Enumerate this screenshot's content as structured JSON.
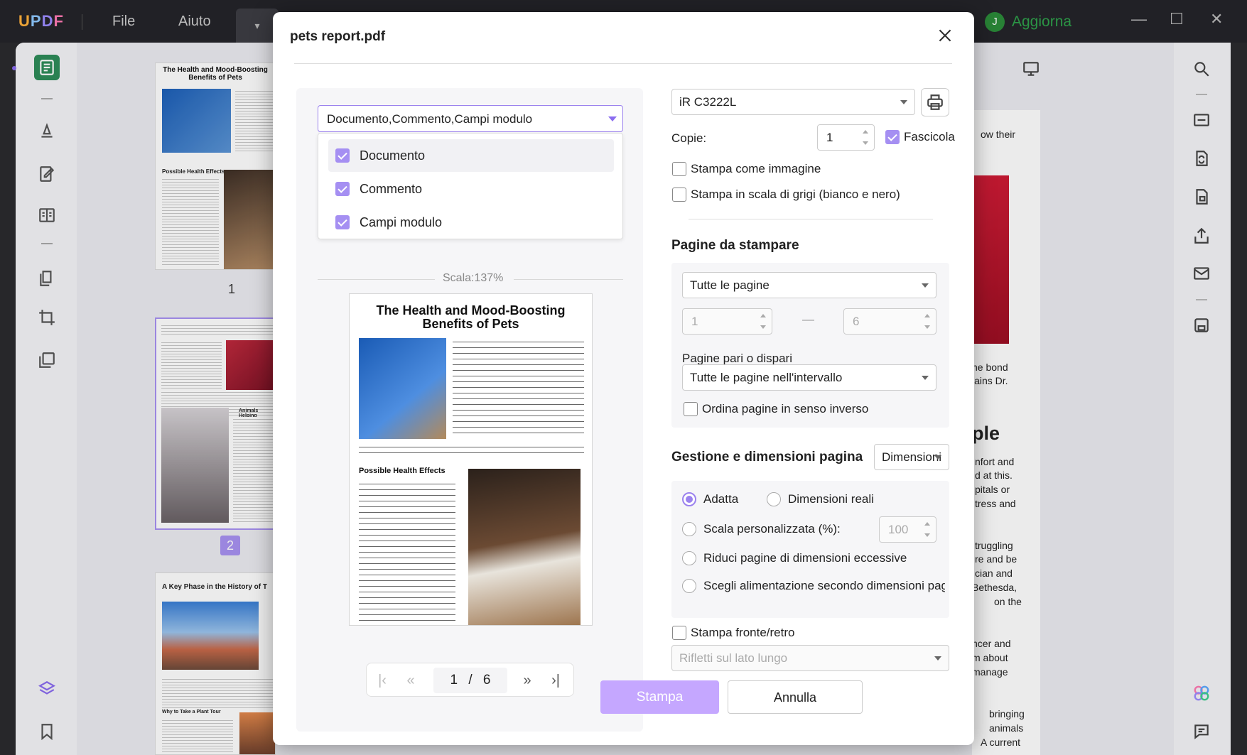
{
  "app": {
    "logo": "UPDF",
    "menu": [
      "File",
      "Aiuto"
    ],
    "upgrade_avatar": "J",
    "upgrade_label": "Aggiorna",
    "brand_colors": {
      "accent": "#9b82ee",
      "green": "#2fa24b"
    }
  },
  "thumbnails": {
    "page1_title": "The Health and Mood-Boosting Benefits of Pets",
    "page1_subhead": "Possible Health Effects",
    "page1_number": "1",
    "page2_subhead": "Animals Helping",
    "page2_number": "2",
    "page3_title": "A Key Phase in the History of T",
    "page3_subhead": "Why to Take a Plant Tour"
  },
  "background_doc": {
    "lines_top": [
      "ow their"
    ],
    "lines_mid": [
      "he bond",
      "lains Dr."
    ],
    "heading": "ple",
    "para1": [
      "nfort and",
      "d at this.",
      "pitals or",
      "tress and"
    ],
    "para2": [
      "truggling",
      "re and be",
      "cian and",
      "Bethesda,",
      "on the"
    ],
    "para3": [
      "ncer and",
      "m about",
      "manage"
    ],
    "para4": [
      "bringing",
      "animals",
      "A current"
    ]
  },
  "dialog": {
    "title": "pets report.pdf",
    "content_select": {
      "value": "Documento,Commento,Campi modulo",
      "options": [
        {
          "label": "Documento",
          "checked": true
        },
        {
          "label": "Commento",
          "checked": true
        },
        {
          "label": "Campi modulo",
          "checked": true
        }
      ]
    },
    "scale_label": "Scala:137%",
    "preview": {
      "title": "The Health and Mood-Boosting Benefits of Pets",
      "subhead": "Possible Health Effects"
    },
    "pager": {
      "current": "1",
      "separator": "/",
      "total": "6"
    },
    "printer": {
      "value": "iR C3222L"
    },
    "copies_label": "Copie:",
    "copies_value": "1",
    "collate_label": "Fascicola",
    "print_as_image": "Stampa come immagine",
    "print_grayscale": "Stampa in scala di grigi (bianco e nero)",
    "pages_section": "Pagine da stampare",
    "pages_select": "Tutte le pagine",
    "range_from": "1",
    "range_dash": "—",
    "range_to": "6",
    "odd_even_label": "Pagine pari o dispari",
    "odd_even_select": "Tutte le pagine nell'intervallo",
    "reverse_label": "Ordina pagine in senso inverso",
    "sizing_section": "Gestione e dimensioni pagina",
    "sizing_select": "Dimensioni",
    "fit_label": "Adatta",
    "actual_size_label": "Dimensioni reali",
    "custom_scale_label": "Scala personalizzata (%):",
    "custom_scale_value": "100",
    "shrink_label": "Riduci pagine di dimensioni eccessive",
    "paper_source_label": "Scegli alimentazione secondo dimensioni pag",
    "duplex_label": "Stampa fronte/retro",
    "flip_select": "Rifletti sul lato lungo",
    "print_button": "Stampa",
    "cancel_button": "Annulla"
  }
}
